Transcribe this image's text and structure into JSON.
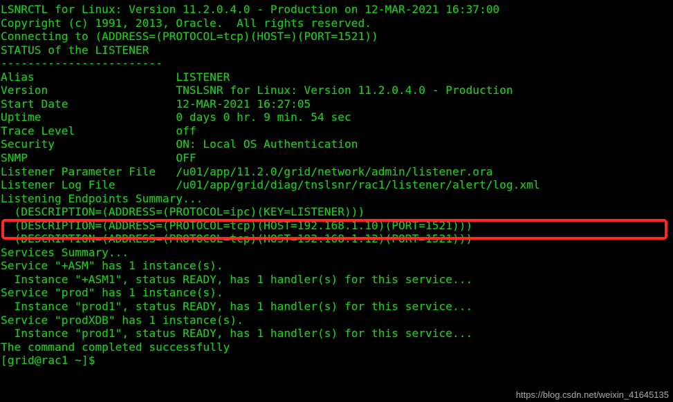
{
  "terminal": {
    "app": "LSNRCTL",
    "foreground_color": "#22c81e",
    "background_color": "#000000",
    "lines": [
      "LSNRCTL for Linux: Version 11.2.0.4.0 - Production on 12-MAR-2021 16:37:00",
      "",
      "Copyright (c) 1991, 2013, Oracle.  All rights reserved.",
      "",
      "Connecting to (ADDRESS=(PROTOCOL=tcp)(HOST=)(PORT=1521))",
      "STATUS of the LISTENER",
      "------------------------",
      "Alias                     LISTENER",
      "Version                   TNSLSNR for Linux: Version 11.2.0.4.0 - Production",
      "Start Date                12-MAR-2021 16:27:05",
      "Uptime                    0 days 0 hr. 9 min. 54 sec",
      "Trace Level               off",
      "Security                  ON: Local OS Authentication",
      "SNMP                      OFF",
      "Listener Parameter File   /u01/app/11.2.0/grid/network/admin/listener.ora",
      "Listener Log File         /u01/app/grid/diag/tnslsnr/rac1/listener/alert/log.xml",
      "Listening Endpoints Summary...",
      "  (DESCRIPTION=(ADDRESS=(PROTOCOL=ipc)(KEY=LISTENER)))",
      "  (DESCRIPTION=(ADDRESS=(PROTOCOL=tcp)(HOST=192.168.1.10)(PORT=1521)))",
      "  (DESCRIPTION=(ADDRESS=(PROTOCOL=tcp)(HOST=192.168.1.12)(PORT=1521)))",
      "Services Summary...",
      "Service \"+ASM\" has 1 instance(s).",
      "  Instance \"+ASM1\", status READY, has 1 handler(s) for this service...",
      "Service \"prod\" has 1 instance(s).",
      "  Instance \"prod1\", status READY, has 1 handler(s) for this service...",
      "Service \"prodXDB\" has 1 instance(s).",
      "  Instance \"prod1\", status READY, has 1 handler(s) for this service...",
      "The command completed successfully",
      "[grid@rac1 ~]$"
    ],
    "status_fields": [
      {
        "label": "Alias",
        "value": "LISTENER"
      },
      {
        "label": "Version",
        "value": "TNSLSNR for Linux: Version 11.2.0.4.0 - Production"
      },
      {
        "label": "Start Date",
        "value": "12-MAR-2021 16:27:05"
      },
      {
        "label": "Uptime",
        "value": "0 days 0 hr. 9 min. 54 sec"
      },
      {
        "label": "Trace Level",
        "value": "off"
      },
      {
        "label": "Security",
        "value": "ON: Local OS Authentication"
      },
      {
        "label": "SNMP",
        "value": "OFF"
      },
      {
        "label": "Listener Parameter File",
        "value": "/u01/app/11.2.0/grid/network/admin/listener.ora"
      },
      {
        "label": "Listener Log File",
        "value": "/u01/app/grid/diag/tnslsnr/rac1/listener/alert/log.xml"
      }
    ]
  },
  "annotation": {
    "highlight_color": "#ff2a1c",
    "highlighted_line": "Listener Log File         /u01/app/grid/diag/tnslsnr/rac1/listener/alert/log.xml"
  },
  "watermark": {
    "text": "https://blog.csdn.net/weixin_41645135",
    "color": "#b9b9b9"
  }
}
